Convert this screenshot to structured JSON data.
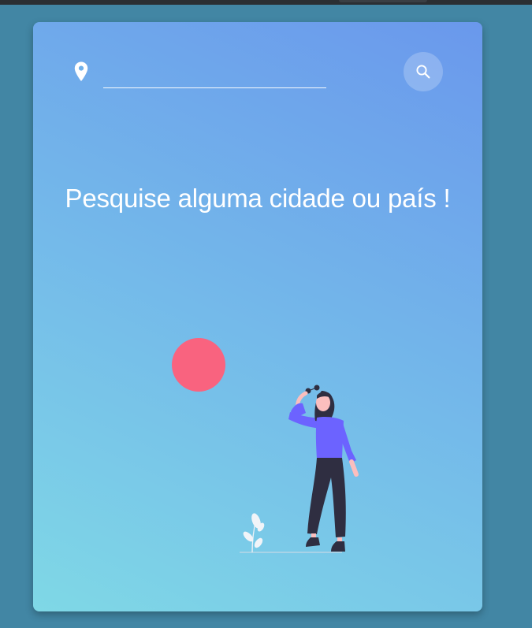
{
  "search": {
    "value": "",
    "placeholder": ""
  },
  "main": {
    "title": "Pesquise alguma cidade ou país !"
  },
  "icons": {
    "location": "map-pin-icon",
    "search": "magnifier-icon"
  },
  "colors": {
    "page_background": "#4286a4",
    "card_gradient_top_right": "#6a98ec",
    "card_gradient_bottom_left": "#7fd8e6",
    "sun": "#f9637f",
    "sweater": "#6c63ff",
    "pants": "#2f2e41"
  }
}
